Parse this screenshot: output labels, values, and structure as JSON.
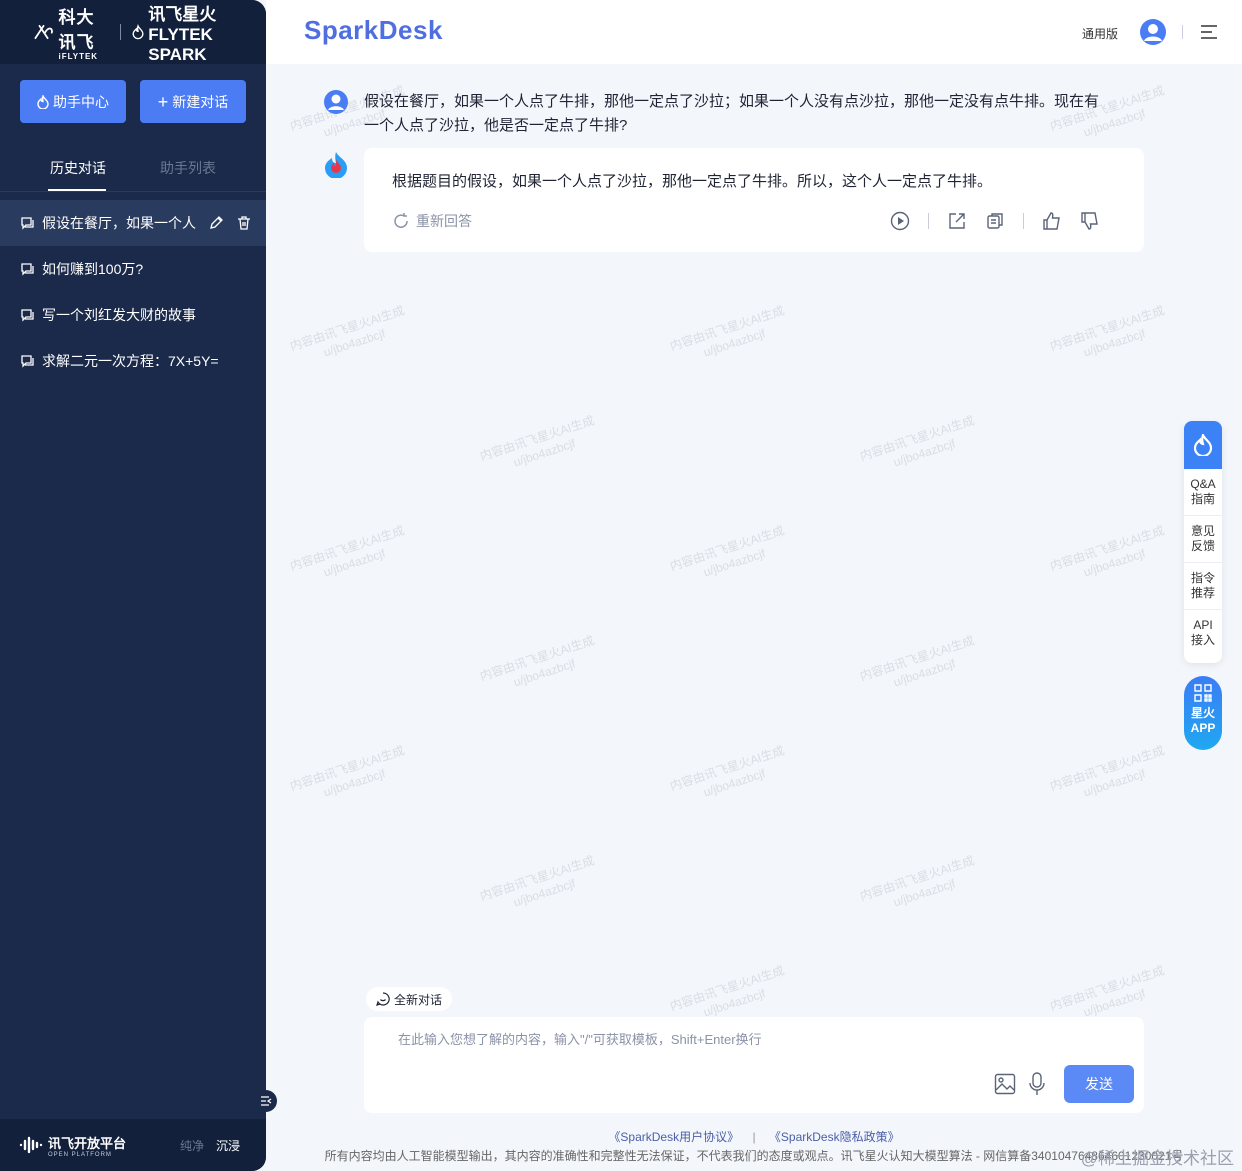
{
  "sidebar": {
    "logo_iflytek": "科大讯飞",
    "logo_iflytek_sub": "iFLYTEK",
    "logo_spark": "讯飞星火",
    "logo_spark_sub": "FLYTEK SPARK",
    "btn_assistant": "助手中心",
    "btn_new": "新建对话",
    "tab_history": "历史对话",
    "tab_assistants": "助手列表",
    "history": [
      "假设在餐厅，如果一个人",
      "如何赚到100万?",
      "写一个刘红发大财的故事",
      "求解二元一次方程：7X+5Y="
    ],
    "footer_logo": "讯飞开放平台",
    "footer_logo_sub": "OPEN PLATFORM",
    "mode_pure": "纯净",
    "mode_immersive": "沉浸"
  },
  "header": {
    "brand": "SparkDesk",
    "version": "通用版"
  },
  "chat": {
    "user_message": "假设在餐厅，如果一个人点了牛排，那他一定点了沙拉；如果一个人没有点沙拉，那他一定没有点牛排。现在有一个人点了沙拉，他是否一定点了牛排?",
    "bot_message": "根据题目的假设，如果一个人点了沙拉，那他一定点了牛排。所以，这个人一定点了牛排。",
    "regenerate": "重新回答"
  },
  "float_panel": {
    "items": [
      "Q&A\n指南",
      "意见\n反馈",
      "指令\n推荐",
      "API\n接入"
    ],
    "app_line1": "星火",
    "app_line2": "APP"
  },
  "input": {
    "new_chat": "全新对话",
    "placeholder": "在此输入您想了解的内容，输入\"/\"可获取模板，Shift+Enter换行",
    "send": "发送"
  },
  "footer": {
    "link_agreement": "《SparkDesk用户协议》",
    "link_privacy": "《SparkDesk隐私政策》",
    "divider": "|",
    "disclaimer": "所有内容均由人工智能模型输出，其内容的准确性和完整性无法保证，不代表我们的态度或观点。讯飞星火认知大模型算法 - 网信算备340104764864601230021号",
    "corner_watermark": "@稀土掘金技术社区"
  },
  "watermark": {
    "line1": "内容由讯飞星火AI生成",
    "line2": "u/jbo4azbcjf"
  },
  "colors": {
    "sidebar_bg": "#1b2a4a",
    "accent": "#4c7cf3",
    "brand": "#4f6fe0"
  }
}
